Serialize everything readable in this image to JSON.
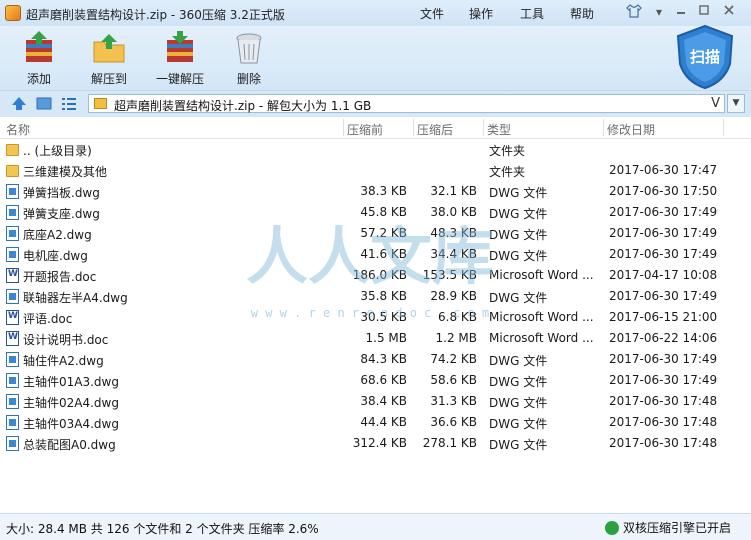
{
  "window": {
    "title": "超声磨削装置结构设计.zip - 360压缩 3.2正式版",
    "menus": [
      "文件",
      "操作",
      "工具",
      "帮助"
    ]
  },
  "toolbar": {
    "add": "添加",
    "extract_to": "解压到",
    "one_click_extract": "一键解压",
    "delete": "删除",
    "scan": "扫描"
  },
  "address": {
    "path": "超声磨削装置结构设计.zip - 解包大小为 1.1 GB",
    "v_glyph": "V"
  },
  "columns": {
    "name": "名称",
    "before": "压缩前",
    "after": "压缩后",
    "type": "类型",
    "modified": "修改日期"
  },
  "files": [
    {
      "icon": "folder",
      "name": ".. (上级目录)",
      "before": "",
      "after": "",
      "type": "文件夹",
      "modified": ""
    },
    {
      "icon": "folder",
      "name": "三维建模及其他",
      "before": "",
      "after": "",
      "type": "文件夹",
      "modified": "2017-06-30 17:47"
    },
    {
      "icon": "dwg",
      "name": "弹簧挡板.dwg",
      "before": "38.3 KB",
      "after": "32.1 KB",
      "type": "DWG 文件",
      "modified": "2017-06-30 17:50"
    },
    {
      "icon": "dwg",
      "name": "弹簧支座.dwg",
      "before": "45.8 KB",
      "after": "38.0 KB",
      "type": "DWG 文件",
      "modified": "2017-06-30 17:49"
    },
    {
      "icon": "dwg",
      "name": "底座A2.dwg",
      "before": "57.2 KB",
      "after": "48.3 KB",
      "type": "DWG 文件",
      "modified": "2017-06-30 17:49"
    },
    {
      "icon": "dwg",
      "name": "电机座.dwg",
      "before": "41.6 KB",
      "after": "34.4 KB",
      "type": "DWG 文件",
      "modified": "2017-06-30 17:49"
    },
    {
      "icon": "doc",
      "name": "开题报告.doc",
      "before": "186.0 KB",
      "after": "153.5 KB",
      "type": "Microsoft Word ...",
      "modified": "2017-04-17 10:08"
    },
    {
      "icon": "dwg",
      "name": "联轴器左半A4.dwg",
      "before": "35.8 KB",
      "after": "28.9 KB",
      "type": "DWG 文件",
      "modified": "2017-06-30 17:49"
    },
    {
      "icon": "doc",
      "name": "评语.doc",
      "before": "30.5 KB",
      "after": "6.8 KB",
      "type": "Microsoft Word ...",
      "modified": "2017-06-15 21:00"
    },
    {
      "icon": "doc",
      "name": "设计说明书.doc",
      "before": "1.5 MB",
      "after": "1.2 MB",
      "type": "Microsoft Word ...",
      "modified": "2017-06-22 14:06"
    },
    {
      "icon": "dwg",
      "name": "轴住件A2.dwg",
      "before": "84.3 KB",
      "after": "74.2 KB",
      "type": "DWG 文件",
      "modified": "2017-06-30 17:49"
    },
    {
      "icon": "dwg",
      "name": "主轴件01A3.dwg",
      "before": "68.6 KB",
      "after": "58.6 KB",
      "type": "DWG 文件",
      "modified": "2017-06-30 17:49"
    },
    {
      "icon": "dwg",
      "name": "主轴件02A4.dwg",
      "before": "38.4 KB",
      "after": "31.3 KB",
      "type": "DWG 文件",
      "modified": "2017-06-30 17:48"
    },
    {
      "icon": "dwg",
      "name": "主轴件03A4.dwg",
      "before": "44.4 KB",
      "after": "36.6 KB",
      "type": "DWG 文件",
      "modified": "2017-06-30 17:48"
    },
    {
      "icon": "dwg",
      "name": "总装配图A0.dwg",
      "before": "312.4 KB",
      "after": "278.1 KB",
      "type": "DWG 文件",
      "modified": "2017-06-30 17:48"
    }
  ],
  "status": {
    "summary": "大小: 28.4 MB 共 126 个文件和 2 个文件夹 压缩率 2.6%",
    "engine": "双核压缩引擎已开启"
  },
  "watermark": {
    "chars": "人人文库",
    "url": "w w w . r e n r e n d o c . c o m"
  }
}
